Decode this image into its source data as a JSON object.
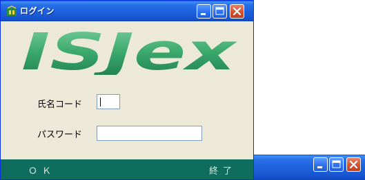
{
  "window": {
    "title": "ログイン",
    "app_icon": "isjex-app-icon"
  },
  "titlebar_buttons": {
    "minimize_icon": "minimize-icon",
    "maximize_icon": "maximize-icon",
    "close_icon": "close-icon"
  },
  "logo": {
    "text": "ISJex",
    "color": "#2e9a63"
  },
  "form": {
    "name_code_label": "氏名コード",
    "name_code_value": "",
    "password_label": "パスワード",
    "password_value": ""
  },
  "footer": {
    "ok_label": "ＯＫ",
    "end_label": "終了"
  },
  "background_window": {
    "minimize_icon": "minimize-icon",
    "maximize_icon": "maximize-icon",
    "close_icon": "close-icon"
  },
  "colors": {
    "titlebar": "#1e63df",
    "window_bg": "#ece9d8",
    "footer_bar": "#0f6d5e",
    "footer_text": "#d8e8e0"
  }
}
